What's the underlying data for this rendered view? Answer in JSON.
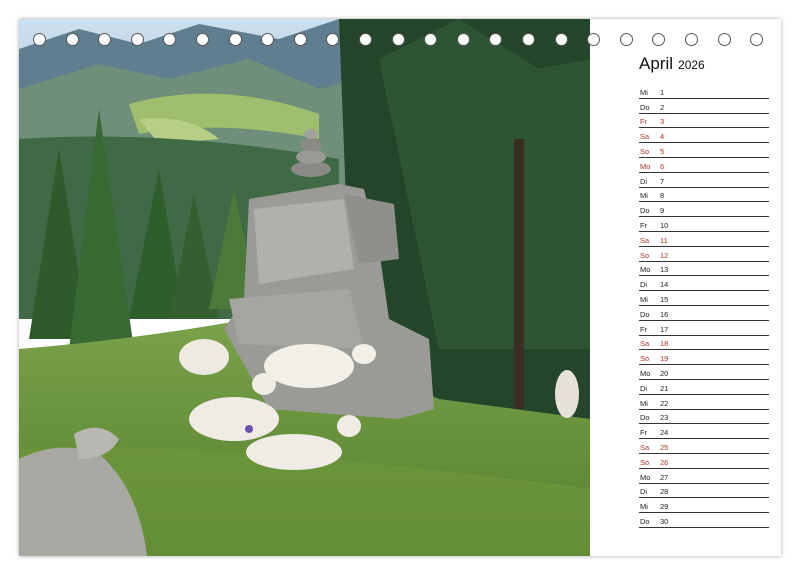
{
  "calendar": {
    "month": "April",
    "year": "2026",
    "accent_color": "#b03020",
    "days": [
      {
        "wd": "Mi",
        "n": "1",
        "red": false
      },
      {
        "wd": "Do",
        "n": "2",
        "red": false
      },
      {
        "wd": "Fr",
        "n": "3",
        "red": true
      },
      {
        "wd": "Sa",
        "n": "4",
        "red": true
      },
      {
        "wd": "So",
        "n": "5",
        "red": true
      },
      {
        "wd": "Mo",
        "n": "6",
        "red": true
      },
      {
        "wd": "Di",
        "n": "7",
        "red": false
      },
      {
        "wd": "Mi",
        "n": "8",
        "red": false
      },
      {
        "wd": "Do",
        "n": "9",
        "red": false
      },
      {
        "wd": "Fr",
        "n": "10",
        "red": false
      },
      {
        "wd": "Sa",
        "n": "11",
        "red": true
      },
      {
        "wd": "So",
        "n": "12",
        "red": true
      },
      {
        "wd": "Mo",
        "n": "13",
        "red": false
      },
      {
        "wd": "Di",
        "n": "14",
        "red": false
      },
      {
        "wd": "Mi",
        "n": "15",
        "red": false
      },
      {
        "wd": "Do",
        "n": "16",
        "red": false
      },
      {
        "wd": "Fr",
        "n": "17",
        "red": false
      },
      {
        "wd": "Sa",
        "n": "18",
        "red": true
      },
      {
        "wd": "So",
        "n": "19",
        "red": true
      },
      {
        "wd": "Mo",
        "n": "20",
        "red": false
      },
      {
        "wd": "Di",
        "n": "21",
        "red": false
      },
      {
        "wd": "Mi",
        "n": "22",
        "red": false
      },
      {
        "wd": "Do",
        "n": "23",
        "red": false
      },
      {
        "wd": "Fr",
        "n": "24",
        "red": false
      },
      {
        "wd": "Sa",
        "n": "25",
        "red": true
      },
      {
        "wd": "So",
        "n": "26",
        "red": true
      },
      {
        "wd": "Mo",
        "n": "27",
        "red": false
      },
      {
        "wd": "Di",
        "n": "28",
        "red": false
      },
      {
        "wd": "Mi",
        "n": "29",
        "red": false
      },
      {
        "wd": "Do",
        "n": "30",
        "red": false
      }
    ]
  },
  "binding": {
    "ring_count": 23
  }
}
